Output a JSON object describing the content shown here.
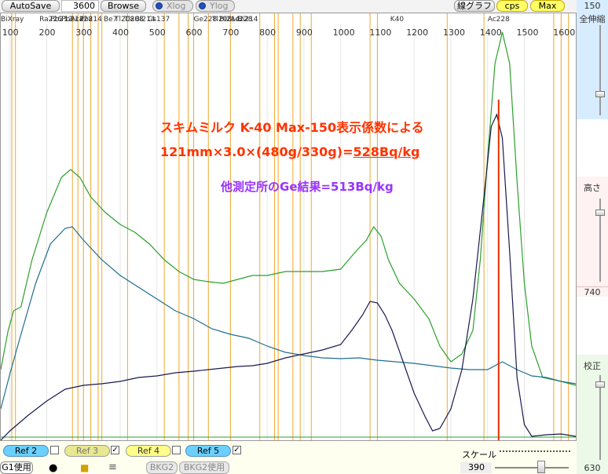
{
  "toolbar": {
    "autosave": "AutoSave",
    "time_value": "3600",
    "browse": "Browse",
    "xlog": "Xlog",
    "ylog": "Ylog",
    "graph_type": "線グラフ",
    "cps": "cps",
    "max": "Max",
    "right_value": "150"
  },
  "right_panel": {
    "top_label": "全伸縮",
    "mid_label": "高さ",
    "mid_value": "740",
    "bot_label": "校正",
    "bot_value": "630"
  },
  "bottom_bar": {
    "ref2": "Ref 2",
    "ref3": "Ref 3",
    "ref4": "Ref 4",
    "ref5": "Ref 5",
    "bg1": "G1使用",
    "bkg2": "BKG2",
    "bkg2use": "BKG2使用",
    "scale_label": "スケール",
    "scale_value": "390"
  },
  "annotations": {
    "line1": "スキムミルク  K-40  Max-150表示係数による",
    "line2_prefix": "121mm×3.0×(480g/330g)=",
    "line2_result": "528Bq/kg",
    "line3": "他測定所のGe結果=513Bq/kg"
  },
  "chart_data": {
    "type": "line",
    "x_ticks": [
      "100",
      "200",
      "300",
      "400",
      "500",
      "600",
      "700",
      "800",
      "900",
      "1000",
      "1100",
      "1200",
      "1300",
      "1400",
      "1500",
      "1600"
    ],
    "xlim": [
      75,
      1640
    ],
    "nuclide_labels": [
      "BiXray",
      "Ra226",
      "Pb212",
      "Pb214",
      "Ac228",
      "Pb214",
      "Be7",
      "Tl208",
      "Tl208",
      "Bi214",
      "Cs137",
      "Ge228",
      "Tl208",
      "Bi214",
      "Ac228",
      "Bi214",
      "K40",
      "Ac228"
    ],
    "series": [
      {
        "color": "#2ca02c",
        "points": [
          [
            75,
            470
          ],
          [
            95,
            420
          ],
          [
            110,
            395
          ],
          [
            130,
            390
          ],
          [
            160,
            330
          ],
          [
            200,
            270
          ],
          [
            240,
            225
          ],
          [
            265,
            215
          ],
          [
            290,
            225
          ],
          [
            320,
            250
          ],
          [
            360,
            270
          ],
          [
            400,
            285
          ],
          [
            440,
            295
          ],
          [
            480,
            310
          ],
          [
            520,
            330
          ],
          [
            560,
            345
          ],
          [
            600,
            355
          ],
          [
            640,
            358
          ],
          [
            680,
            360
          ],
          [
            720,
            355
          ],
          [
            760,
            350
          ],
          [
            800,
            350
          ],
          [
            850,
            345
          ],
          [
            900,
            345
          ],
          [
            950,
            345
          ],
          [
            1000,
            342
          ],
          [
            1040,
            320
          ],
          [
            1070,
            305
          ],
          [
            1090,
            288
          ],
          [
            1110,
            300
          ],
          [
            1130,
            330
          ],
          [
            1160,
            360
          ],
          [
            1200,
            380
          ],
          [
            1240,
            405
          ],
          [
            1270,
            440
          ],
          [
            1300,
            460
          ],
          [
            1330,
            450
          ],
          [
            1360,
            420
          ],
          [
            1380,
            330
          ],
          [
            1400,
            200
          ],
          [
            1420,
            80
          ],
          [
            1440,
            40
          ],
          [
            1460,
            80
          ],
          [
            1480,
            230
          ],
          [
            1500,
            360
          ],
          [
            1520,
            440
          ],
          [
            1550,
            480
          ],
          [
            1600,
            485
          ],
          [
            1640,
            490
          ]
        ]
      },
      {
        "color": "#1f6f8f",
        "points": [
          [
            75,
            520
          ],
          [
            100,
            475
          ],
          [
            130,
            425
          ],
          [
            170,
            360
          ],
          [
            210,
            310
          ],
          [
            250,
            290
          ],
          [
            270,
            288
          ],
          [
            300,
            305
          ],
          [
            350,
            330
          ],
          [
            400,
            350
          ],
          [
            450,
            365
          ],
          [
            500,
            380
          ],
          [
            550,
            395
          ],
          [
            600,
            405
          ],
          [
            650,
            418
          ],
          [
            700,
            425
          ],
          [
            750,
            430
          ],
          [
            800,
            440
          ],
          [
            850,
            448
          ],
          [
            900,
            452
          ],
          [
            950,
            455
          ],
          [
            1000,
            456
          ],
          [
            1050,
            455
          ],
          [
            1100,
            458
          ],
          [
            1150,
            460
          ],
          [
            1200,
            462
          ],
          [
            1250,
            465
          ],
          [
            1300,
            468
          ],
          [
            1350,
            470
          ],
          [
            1400,
            470
          ],
          [
            1440,
            460
          ],
          [
            1480,
            470
          ],
          [
            1520,
            478
          ],
          [
            1560,
            480
          ],
          [
            1600,
            485
          ],
          [
            1640,
            488
          ]
        ]
      },
      {
        "color": "#1a1a50",
        "points": [
          [
            75,
            560
          ],
          [
            100,
            548
          ],
          [
            150,
            528
          ],
          [
            200,
            510
          ],
          [
            250,
            495
          ],
          [
            300,
            490
          ],
          [
            350,
            488
          ],
          [
            400,
            485
          ],
          [
            450,
            480
          ],
          [
            500,
            478
          ],
          [
            550,
            474
          ],
          [
            600,
            472
          ],
          [
            640,
            470
          ],
          [
            680,
            468
          ],
          [
            720,
            466
          ],
          [
            760,
            465
          ],
          [
            800,
            462
          ],
          [
            850,
            455
          ],
          [
            900,
            450
          ],
          [
            950,
            445
          ],
          [
            1000,
            438
          ],
          [
            1030,
            420
          ],
          [
            1060,
            400
          ],
          [
            1080,
            383
          ],
          [
            1100,
            385
          ],
          [
            1120,
            400
          ],
          [
            1140,
            420
          ],
          [
            1170,
            460
          ],
          [
            1200,
            500
          ],
          [
            1230,
            530
          ],
          [
            1250,
            548
          ],
          [
            1270,
            545
          ],
          [
            1300,
            520
          ],
          [
            1330,
            470
          ],
          [
            1360,
            380
          ],
          [
            1390,
            250
          ],
          [
            1410,
            160
          ],
          [
            1425,
            145
          ],
          [
            1440,
            175
          ],
          [
            1460,
            320
          ],
          [
            1480,
            480
          ],
          [
            1500,
            540
          ],
          [
            1520,
            555
          ],
          [
            1560,
            553
          ],
          [
            1600,
            552
          ],
          [
            1640,
            555
          ]
        ]
      }
    ],
    "marker_x": 1430
  }
}
